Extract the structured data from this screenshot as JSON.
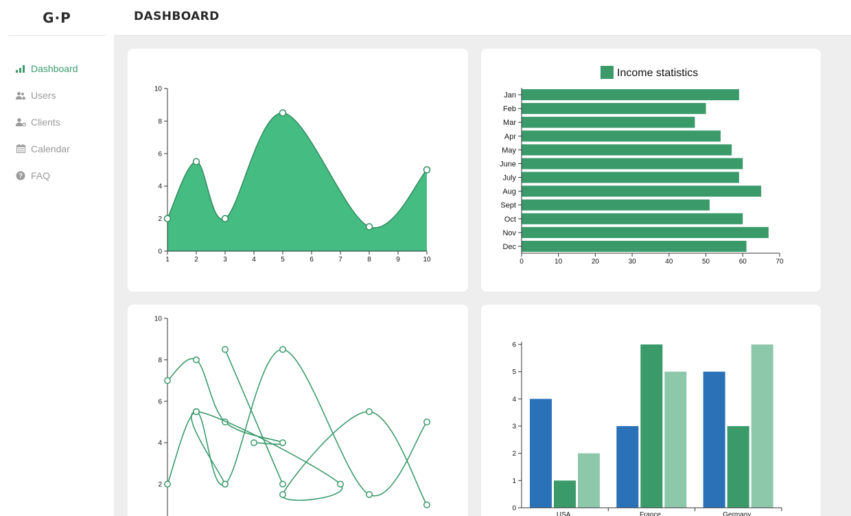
{
  "app": {
    "logo": "G·P"
  },
  "header": {
    "title": "DASHBOARD"
  },
  "sidebar": {
    "items": [
      {
        "label": "Dashboard",
        "icon": "bar-chart-icon",
        "active": true
      },
      {
        "label": "Users",
        "icon": "users-icon",
        "active": false
      },
      {
        "label": "Clients",
        "icon": "clients-icon",
        "active": false
      },
      {
        "label": "Calendar",
        "icon": "calendar-icon",
        "active": false
      },
      {
        "label": "FAQ",
        "icon": "question-icon",
        "active": false
      }
    ]
  },
  "colors": {
    "accent": "#3a9a6a",
    "area_fill": "#45bd82",
    "area_stroke": "#2f8a5e",
    "bar_green": "#3a9a6a",
    "bar_blue": "#2a71b8",
    "bar_light": "#8dc8ab"
  },
  "chart_data": [
    {
      "type": "area",
      "x": [
        1,
        2,
        3,
        5,
        8,
        10
      ],
      "y": [
        2,
        5.5,
        2,
        8.5,
        1.5,
        5
      ],
      "xticks": [
        1,
        2,
        3,
        4,
        5,
        6,
        7,
        8,
        9,
        10
      ],
      "yticks": [
        0,
        2,
        4,
        6,
        8,
        10
      ],
      "xlim": [
        1,
        10
      ],
      "ylim": [
        0,
        10
      ],
      "markers": true
    },
    {
      "type": "bar",
      "orientation": "horizontal",
      "legend": "Income statistics",
      "categories": [
        "Jan",
        "Feb",
        "Mar",
        "Apr",
        "May",
        "June",
        "July",
        "Aug",
        "Sept",
        "Oct",
        "Nov",
        "Dec"
      ],
      "values": [
        59,
        50,
        47,
        54,
        57,
        60,
        59,
        65,
        51,
        60,
        67,
        61
      ],
      "xticks": [
        0,
        10,
        20,
        30,
        40,
        50,
        60,
        70
      ],
      "xlim": [
        0,
        70
      ]
    },
    {
      "type": "line",
      "series": [
        {
          "x": [
            1,
            2,
            3,
            5,
            4
          ],
          "y": [
            7,
            8,
            5,
            4,
            4
          ]
        },
        {
          "x": [
            1,
            2,
            3,
            5,
            8,
            10
          ],
          "y": [
            2,
            5.5,
            2,
            8.5,
            1.5,
            5
          ]
        },
        {
          "x": [
            10,
            8,
            5,
            7,
            2,
            3
          ],
          "y": [
            1,
            5.5,
            1.5,
            2,
            5.5,
            2
          ]
        },
        {
          "x": [
            3,
            5
          ],
          "y": [
            8.5,
            2
          ]
        }
      ],
      "yticks": [
        2,
        4,
        6,
        8,
        10
      ],
      "ylim": [
        0,
        10
      ],
      "markers": true
    },
    {
      "type": "bar",
      "orientation": "vertical",
      "categories": [
        "USA",
        "France",
        "Germany"
      ],
      "series": [
        {
          "values": [
            4,
            3,
            5
          ]
        },
        {
          "values": [
            1,
            6,
            3
          ]
        },
        {
          "values": [
            2,
            5,
            6
          ]
        }
      ],
      "yticks": [
        0,
        1,
        2,
        3,
        4,
        5,
        6
      ],
      "ylim": [
        0,
        6
      ]
    }
  ]
}
